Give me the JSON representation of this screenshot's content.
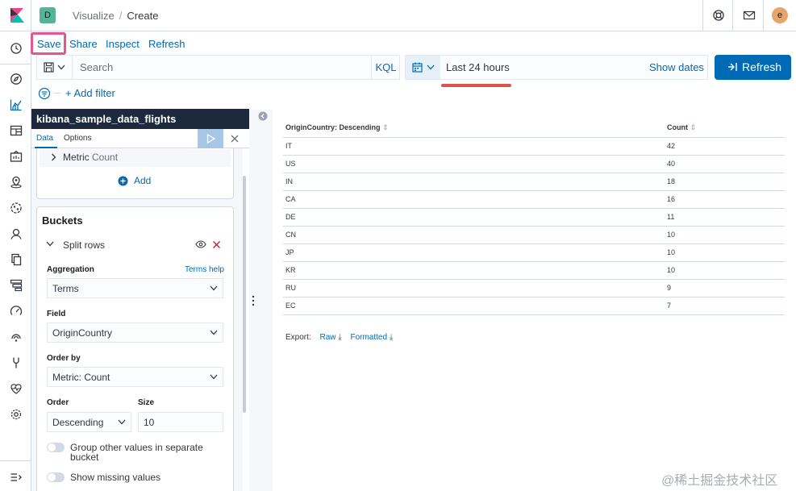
{
  "header": {
    "space_initial": "D",
    "breadcrumbs": [
      "Visualize",
      "Create"
    ],
    "user_initial": "e"
  },
  "top_menu": [
    "Save",
    "Share",
    "Inspect",
    "Refresh"
  ],
  "query_bar": {
    "placeholder": "Search",
    "language": "KQL"
  },
  "time_picker": {
    "range": "Last 24 hours",
    "show_dates": "Show dates",
    "refresh_label": "Refresh"
  },
  "filters": {
    "add_filter": "+ Add filter"
  },
  "sidebar": {
    "index_pattern": "kibana_sample_data_flights",
    "tabs": [
      "Data",
      "Options"
    ],
    "metrics": {
      "metric_label": "Metric",
      "metric_value": "Count",
      "add_label": "Add"
    },
    "buckets": {
      "title": "Buckets",
      "split_label": "Split rows",
      "aggregation_label": "Aggregation",
      "terms_help": "Terms help",
      "aggregation_value": "Terms",
      "field_label": "Field",
      "field_value": "OriginCountry",
      "order_by_label": "Order by",
      "order_by_value": "Metric: Count",
      "order_label": "Order",
      "order_value": "Descending",
      "size_label": "Size",
      "size_value": "10",
      "group_other_label": "Group other values in separate bucket",
      "show_missing_label": "Show missing values"
    }
  },
  "table": {
    "columns": [
      "OriginCountry: Descending",
      "Count"
    ],
    "rows": [
      [
        "IT",
        "42"
      ],
      [
        "US",
        "40"
      ],
      [
        "IN",
        "18"
      ],
      [
        "CA",
        "16"
      ],
      [
        "DE",
        "11"
      ],
      [
        "CN",
        "10"
      ],
      [
        "JP",
        "10"
      ],
      [
        "KR",
        "10"
      ],
      [
        "RU",
        "9"
      ],
      [
        "EC",
        "7"
      ]
    ]
  },
  "export": {
    "label": "Export:",
    "raw": "Raw",
    "formatted": "Formatted"
  },
  "watermark": "@稀土掘金技术社区",
  "colors": {
    "accent": "#006bb4",
    "sidebar_title_bg": "#1d2a3e",
    "highlight": "#e3578d",
    "underline": "#d9534f"
  }
}
